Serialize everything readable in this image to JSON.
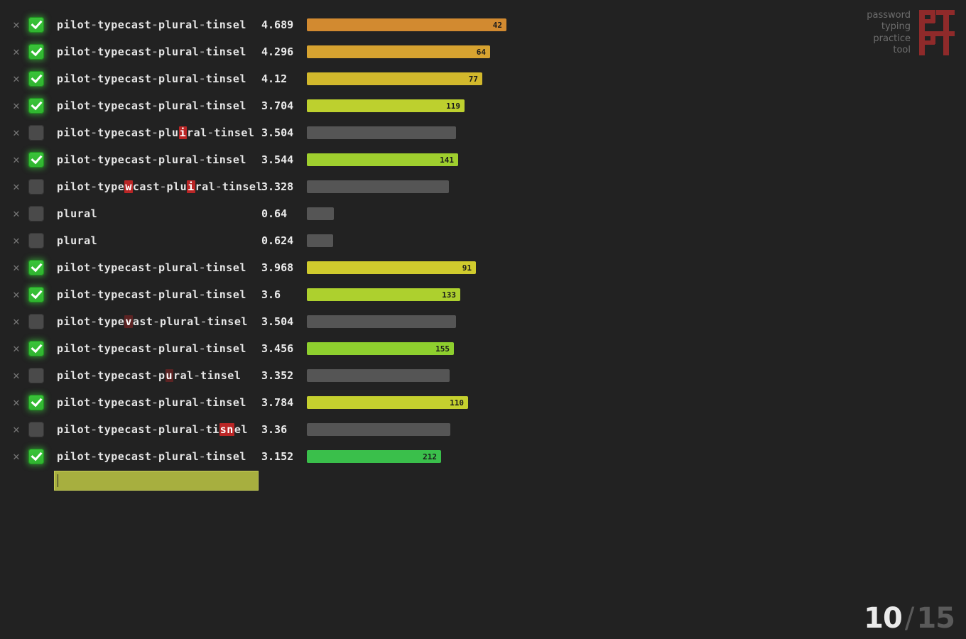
{
  "brand": {
    "line1": "password",
    "line2": "typing",
    "line3": "practice",
    "line4": "tool"
  },
  "score": {
    "correct": "10",
    "total": "15"
  },
  "target_phrase": "pilot-typecast-plural-tinsel",
  "bar_max": 500,
  "bar_unit_ratio": 60,
  "attempts": [
    {
      "text": "pilot-typecast-plural-tinsel",
      "errors": [],
      "ok": true,
      "time": "4.689",
      "speed": 42,
      "color": "#d28a30"
    },
    {
      "text": "pilot-typecast-plural-tinsel",
      "errors": [],
      "ok": true,
      "time": "4.296",
      "speed": 64,
      "color": "#d7a330"
    },
    {
      "text": "pilot-typecast-plural-tinsel",
      "errors": [],
      "ok": true,
      "time": "4.12",
      "speed": 77,
      "color": "#d2b82c"
    },
    {
      "text": "pilot-typecast-plural-tinsel",
      "errors": [],
      "ok": true,
      "time": "3.704",
      "speed": 119,
      "color": "#bdd02e"
    },
    {
      "text": "pilot-typecast-pluiral-tinsel",
      "errors": [
        {
          "i": 18,
          "len": 1,
          "ghost": false
        }
      ],
      "ok": false,
      "time": "3.504"
    },
    {
      "text": "pilot-typecast-plural-tinsel",
      "errors": [],
      "ok": true,
      "time": "3.544",
      "speed": 141,
      "color": "#9fcf2e"
    },
    {
      "text": "pilot-typewcast-pluiral-tinsel",
      "errors": [
        {
          "i": 10,
          "len": 1,
          "ghost": false
        },
        {
          "i": 19,
          "len": 1,
          "ghost": false
        }
      ],
      "ok": false,
      "time": "3.328"
    },
    {
      "text": "plural",
      "errors": [],
      "ok": false,
      "time": "0.64"
    },
    {
      "text": "plural",
      "errors": [],
      "ok": false,
      "time": "0.624"
    },
    {
      "text": "pilot-typecast-plural-tinsel",
      "errors": [],
      "ok": true,
      "time": "3.968",
      "speed": 91,
      "color": "#d0cb2d"
    },
    {
      "text": "pilot-typecast-plural-tinsel",
      "errors": [],
      "ok": true,
      "time": "3.6",
      "speed": 133,
      "color": "#add02e"
    },
    {
      "text": "pilot-typevast-plural-tinsel",
      "errors": [
        {
          "i": 10,
          "len": 1,
          "ghost": true
        }
      ],
      "ok": false,
      "time": "3.504"
    },
    {
      "text": "pilot-typecast-plural-tinsel",
      "errors": [],
      "ok": true,
      "time": "3.456",
      "speed": 155,
      "color": "#8ecf2e"
    },
    {
      "text": "pilot-typecast-pural-tinsel",
      "errors": [
        {
          "i": 16,
          "len": 1,
          "ghost": true
        }
      ],
      "ok": false,
      "time": "3.352"
    },
    {
      "text": "pilot-typecast-plural-tinsel",
      "errors": [],
      "ok": true,
      "time": "3.784",
      "speed": 110,
      "color": "#c5d02e"
    },
    {
      "text": "pilot-typecast-plural-tisnel",
      "errors": [
        {
          "i": 24,
          "len": 2,
          "ghost": false
        }
      ],
      "ok": false,
      "time": "3.36"
    },
    {
      "text": "pilot-typecast-plural-tinsel",
      "errors": [],
      "ok": true,
      "time": "3.152",
      "speed": 212,
      "color": "#3abf4b"
    }
  ]
}
